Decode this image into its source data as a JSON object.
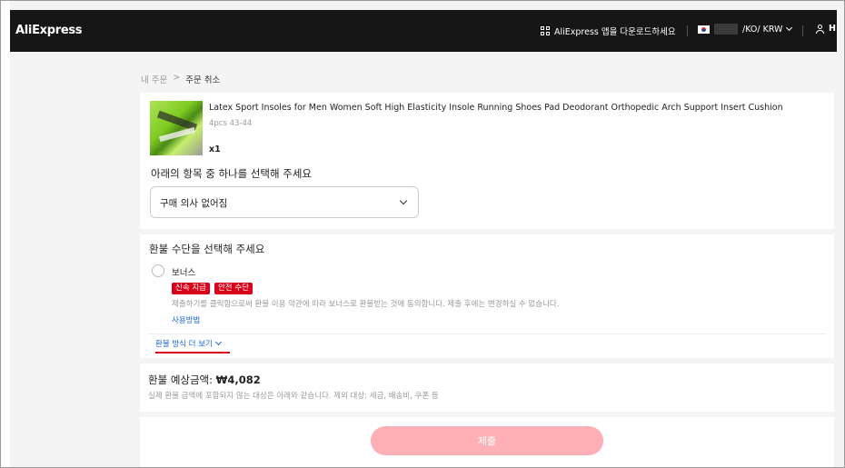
{
  "header": {
    "logo": "AliExpress",
    "app_download": "AliExpress 앱을 다운로드하세요",
    "locale": "/KO/ KRW",
    "user_initial": "H"
  },
  "breadcrumb": {
    "parent": "내 주문",
    "separator": ">",
    "current": "주문 취소"
  },
  "product": {
    "title": "Latex Sport Insoles for Men Women Soft High Elasticity Insole Running Shoes Pad Deodorant Orthopedic Arch Support Insert Cushion",
    "sku": "4pcs 43-44",
    "quantity": "x1"
  },
  "reason": {
    "prompt": "아래의 항목 중 하나를 선택해 주세요",
    "selected": "구매 의사 없어짐"
  },
  "refund_method": {
    "prompt": "환불 수단을 선택해 주세요",
    "option_label": "보너스",
    "badges": [
      "신속 지급",
      "안전 수단"
    ],
    "description": "제출하기를 클릭함으로써 환불 이용 약관에 따라 보너스로 환불받는 것에 동의합니다. 제출 후에는 변경하실 수 없습니다.",
    "usage_link": "사용방법",
    "more_link": "환불 방식 더 보기"
  },
  "refund_estimate": {
    "label": "환불 예상금액:",
    "amount": "₩4,082",
    "note": "실제 환불 금액에 포함되지 않는 대상은 아래와 같습니다. 제외 대상: 세금, 배송비, 쿠폰 등"
  },
  "submit_label": "제출",
  "colors": {
    "accent": "#d8001a",
    "link": "#1a66d8",
    "submit_disabled": "#ffb0b6"
  }
}
